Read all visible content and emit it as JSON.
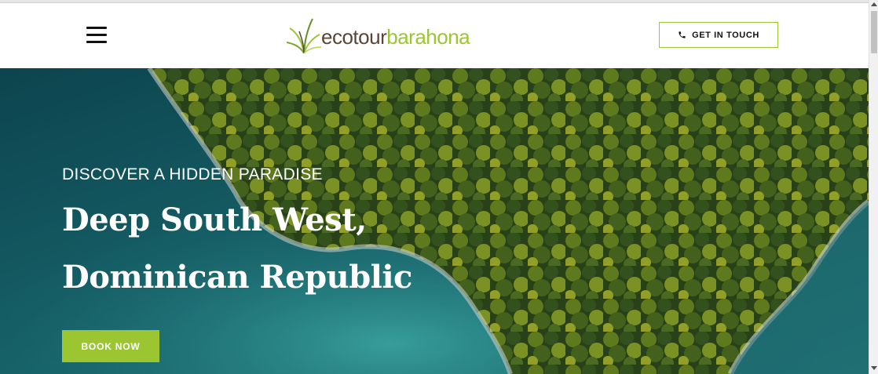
{
  "header": {
    "menu_icon": "hamburger-icon",
    "logo": {
      "part1": "ecotour",
      "part2": "barahona",
      "icon": "grass-leaf-icon"
    },
    "cta": {
      "label": "GET IN TOUCH",
      "icon": "phone-icon"
    }
  },
  "hero": {
    "eyebrow": "DISCOVER A HIDDEN PARADISE",
    "title_line1": "Deep South West,",
    "title_line2": "Dominican Republic",
    "button": "BOOK NOW",
    "background": "aerial-coast-forest-image"
  },
  "colors": {
    "accent": "#9cc631",
    "logo_dark": "#5a4634",
    "sea": "#14555f"
  }
}
